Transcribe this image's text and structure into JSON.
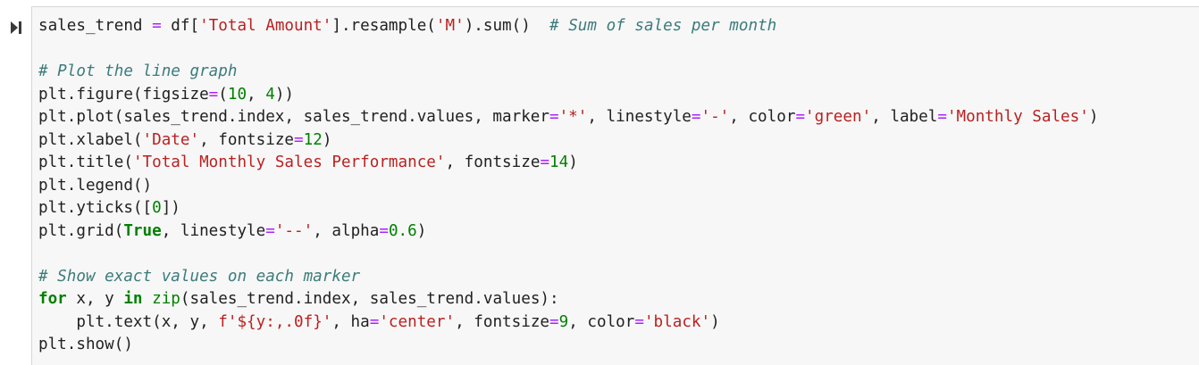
{
  "cell": {
    "run_icon": "run-cell-icon",
    "lines": [
      [
        {
          "t": "sales_trend ",
          "c": ""
        },
        {
          "t": "=",
          "c": "op"
        },
        {
          "t": " df[",
          "c": ""
        },
        {
          "t": "'Total Amount'",
          "c": "str"
        },
        {
          "t": "].resample(",
          "c": ""
        },
        {
          "t": "'M'",
          "c": "str"
        },
        {
          "t": ").sum()  ",
          "c": ""
        },
        {
          "t": "# Sum of sales per month",
          "c": "com"
        }
      ],
      [],
      [
        {
          "t": "# Plot the line graph",
          "c": "com"
        }
      ],
      [
        {
          "t": "plt.figure(figsize",
          "c": ""
        },
        {
          "t": "=",
          "c": "op"
        },
        {
          "t": "(",
          "c": ""
        },
        {
          "t": "10",
          "c": "num"
        },
        {
          "t": ", ",
          "c": ""
        },
        {
          "t": "4",
          "c": "num"
        },
        {
          "t": "))",
          "c": ""
        }
      ],
      [
        {
          "t": "plt.plot(sales_trend.index, sales_trend.values, marker",
          "c": ""
        },
        {
          "t": "=",
          "c": "op"
        },
        {
          "t": "'*'",
          "c": "str"
        },
        {
          "t": ", linestyle",
          "c": ""
        },
        {
          "t": "=",
          "c": "op"
        },
        {
          "t": "'-'",
          "c": "str"
        },
        {
          "t": ", color",
          "c": ""
        },
        {
          "t": "=",
          "c": "op"
        },
        {
          "t": "'green'",
          "c": "str"
        },
        {
          "t": ", label",
          "c": ""
        },
        {
          "t": "=",
          "c": "op"
        },
        {
          "t": "'Monthly Sales'",
          "c": "str"
        },
        {
          "t": ")",
          "c": ""
        }
      ],
      [
        {
          "t": "plt.xlabel(",
          "c": ""
        },
        {
          "t": "'Date'",
          "c": "str"
        },
        {
          "t": ", fontsize",
          "c": ""
        },
        {
          "t": "=",
          "c": "op"
        },
        {
          "t": "12",
          "c": "num"
        },
        {
          "t": ")",
          "c": ""
        }
      ],
      [
        {
          "t": "plt.title(",
          "c": ""
        },
        {
          "t": "'Total Monthly Sales Performance'",
          "c": "str"
        },
        {
          "t": ", fontsize",
          "c": ""
        },
        {
          "t": "=",
          "c": "op"
        },
        {
          "t": "14",
          "c": "num"
        },
        {
          "t": ")",
          "c": ""
        }
      ],
      [
        {
          "t": "plt.legend()",
          "c": ""
        }
      ],
      [
        {
          "t": "plt.yticks([",
          "c": ""
        },
        {
          "t": "0",
          "c": "num"
        },
        {
          "t": "])",
          "c": ""
        }
      ],
      [
        {
          "t": "plt.grid(",
          "c": ""
        },
        {
          "t": "True",
          "c": "kw"
        },
        {
          "t": ", linestyle",
          "c": ""
        },
        {
          "t": "=",
          "c": "op"
        },
        {
          "t": "'--'",
          "c": "str"
        },
        {
          "t": ", alpha",
          "c": ""
        },
        {
          "t": "=",
          "c": "op"
        },
        {
          "t": "0.6",
          "c": "num"
        },
        {
          "t": ")",
          "c": ""
        }
      ],
      [],
      [
        {
          "t": "# Show exact values on each marker",
          "c": "com"
        }
      ],
      [
        {
          "t": "for",
          "c": "kw"
        },
        {
          "t": " x, y ",
          "c": ""
        },
        {
          "t": "in",
          "c": "kw"
        },
        {
          "t": " ",
          "c": ""
        },
        {
          "t": "zip",
          "c": "bi"
        },
        {
          "t": "(sales_trend.index, sales_trend.values):",
          "c": ""
        }
      ],
      [
        {
          "t": "    plt.text(x, y, ",
          "c": ""
        },
        {
          "t": "f'${y:,.0f}'",
          "c": "str"
        },
        {
          "t": ", ha",
          "c": ""
        },
        {
          "t": "=",
          "c": "op"
        },
        {
          "t": "'center'",
          "c": "str"
        },
        {
          "t": ", fontsize",
          "c": ""
        },
        {
          "t": "=",
          "c": "op"
        },
        {
          "t": "9",
          "c": "num"
        },
        {
          "t": ", color",
          "c": ""
        },
        {
          "t": "=",
          "c": "op"
        },
        {
          "t": "'black'",
          "c": "str"
        },
        {
          "t": ")",
          "c": ""
        }
      ],
      [
        {
          "t": "plt.show()",
          "c": ""
        }
      ]
    ]
  }
}
